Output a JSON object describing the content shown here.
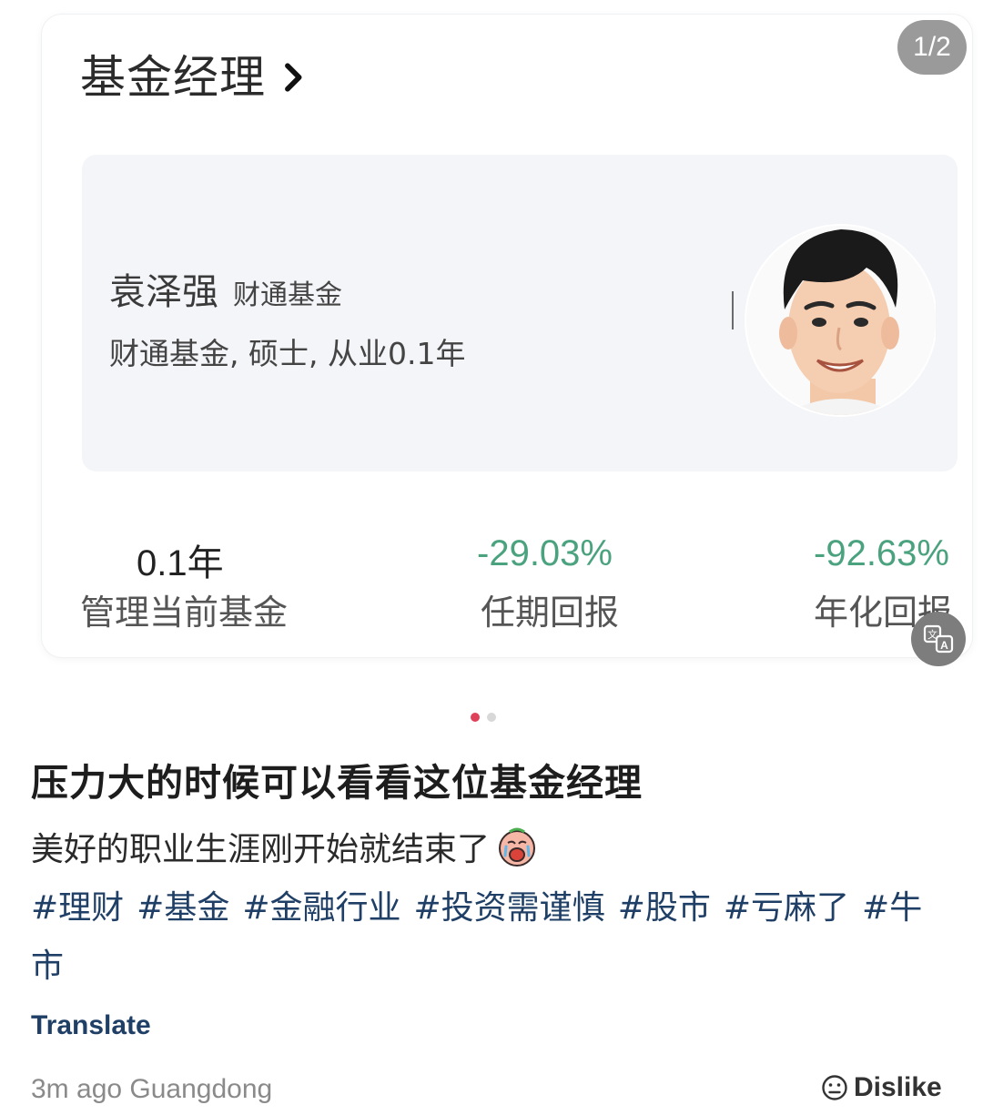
{
  "card": {
    "title": "基金经理",
    "page_counter": "1/2",
    "manager": {
      "name": "袁泽强",
      "company": "财通基金",
      "description": "财通基金, 硕士, 从业0.1年"
    },
    "stats": [
      {
        "value": "0.1年",
        "label": "管理当前基金",
        "color": "#333333"
      },
      {
        "value": "-29.03%",
        "label": "任期回报",
        "color": "#4aa27e"
      },
      {
        "value": "-92.63%",
        "label": "年化回报",
        "color": "#4aa27e"
      }
    ]
  },
  "carousel": {
    "current": 1,
    "total": 2
  },
  "post": {
    "title": "压力大的时候可以看看这位基金经理",
    "body": "美好的职业生涯刚开始就结束了",
    "hashtags": [
      "#理财",
      "#基金",
      "#金融行业",
      "#投资需谨慎",
      "#股市",
      "#亏麻了",
      "#牛市"
    ],
    "translate_label": "Translate",
    "time_location": "3m ago Guangdong",
    "dislike_label": "Dislike"
  },
  "icons": {
    "chevron": "chevron-right-icon",
    "translate": "translate-icon",
    "emoji": "crying-face-emoji",
    "dislike": "neutral-face-icon"
  }
}
